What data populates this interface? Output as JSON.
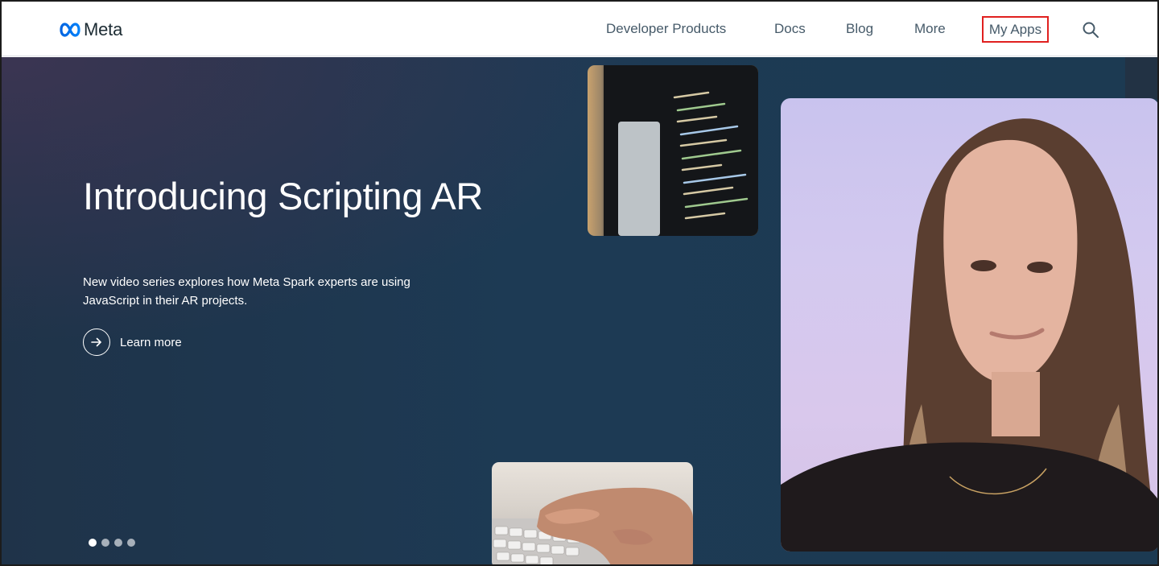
{
  "header": {
    "logo_text": "Meta",
    "nav": {
      "developer_products": "Developer Products",
      "docs": "Docs",
      "blog": "Blog",
      "more": "More",
      "my_apps": "My Apps"
    },
    "icons": {
      "search": "search-icon",
      "logo": "meta-infinity-icon"
    }
  },
  "hero": {
    "title": "Introducing Scripting AR",
    "subtitle": "New video series explores how Meta Spark experts are using JavaScript in their AR projects.",
    "cta_label": "Learn more",
    "cta_icon": "arrow-right-icon",
    "carousel": {
      "total": 4,
      "active_index": 0
    }
  },
  "colors": {
    "hero_background": "#1d3a54",
    "nav_text": "#465a69",
    "logo_blue": "#0668e1",
    "highlight_box": "#e0201f"
  }
}
